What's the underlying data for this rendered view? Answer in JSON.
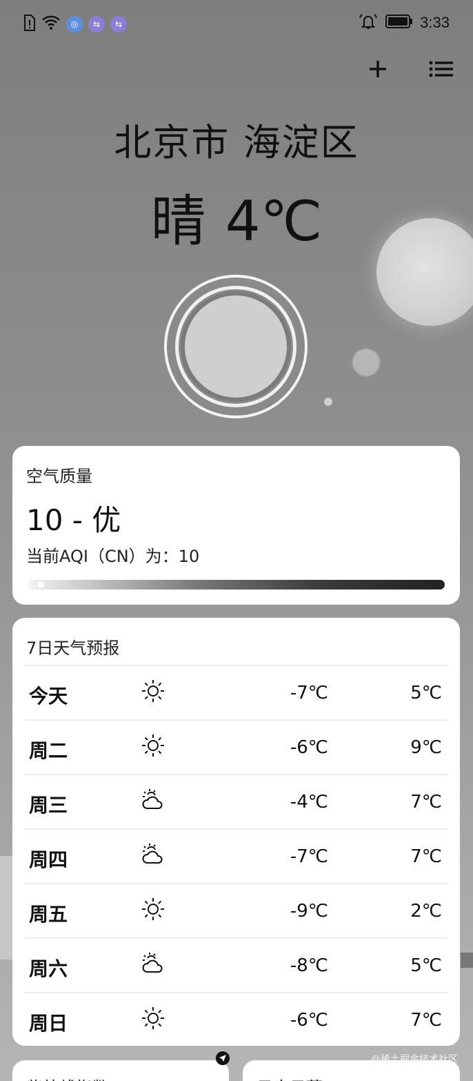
{
  "status_bar": {
    "time": "3:33",
    "left_icons": [
      "sim-alert-icon",
      "wifi-icon",
      "app-notification-icon",
      "usb-icon",
      "usb-icon"
    ],
    "right_icons": [
      "bell-ring-icon",
      "battery-icon"
    ]
  },
  "top_actions": {
    "add": "add-icon",
    "menu": "list-menu-icon"
  },
  "hero": {
    "location": "北京市 海淀区",
    "condition": "晴",
    "temperature": "4℃"
  },
  "aqi": {
    "title": "空气质量",
    "value": "10 - 优",
    "description": "当前AQI（CN）为：10",
    "level": 0.02
  },
  "forecast": {
    "title": "7日天气预报",
    "days": [
      {
        "day": "今天",
        "icon": "sun-icon",
        "low": "-7℃",
        "high": "5℃"
      },
      {
        "day": "周二",
        "icon": "sun-icon",
        "low": "-6℃",
        "high": "9℃"
      },
      {
        "day": "周三",
        "icon": "partly-cloudy-icon",
        "low": "-4℃",
        "high": "7℃"
      },
      {
        "day": "周四",
        "icon": "partly-cloudy-icon",
        "low": "-7℃",
        "high": "7℃"
      },
      {
        "day": "周五",
        "icon": "sun-icon",
        "low": "-9℃",
        "high": "2℃"
      },
      {
        "day": "周六",
        "icon": "partly-cloudy-icon",
        "low": "-8℃",
        "high": "5℃"
      },
      {
        "day": "周日",
        "icon": "sun-icon",
        "low": "-6℃",
        "high": "7℃"
      }
    ]
  },
  "bottom_cards": {
    "left_title": "紫外线指数",
    "right_title": "日出日落"
  },
  "watermark": "@稀土掘金技术社区"
}
